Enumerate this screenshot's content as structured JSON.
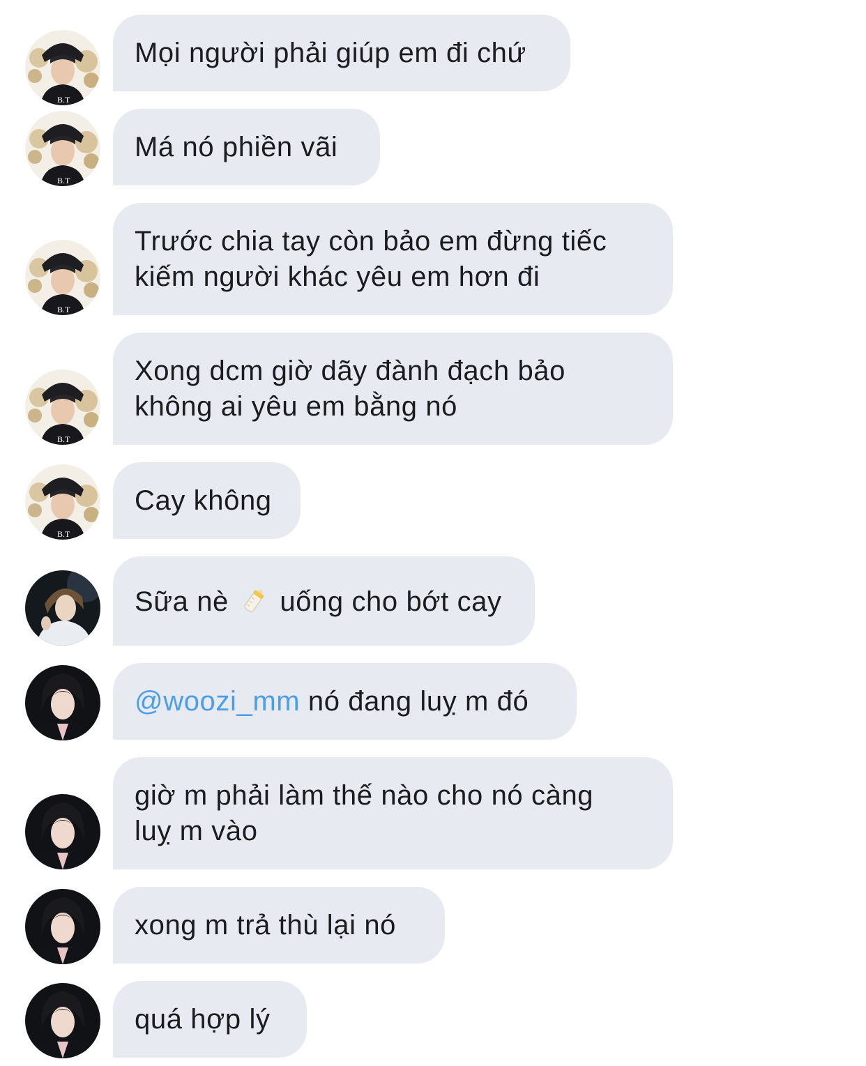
{
  "conversation": {
    "messages": [
      {
        "sender": "user-a",
        "text": "Mọi người phải giúp em đi chứ"
      },
      {
        "sender": "user-a",
        "text": "Má nó phiền vãi"
      },
      {
        "sender": "user-a",
        "line1": "Trước chia tay còn bảo em đừng tiếc",
        "line2": "kiếm người khác yêu em hơn đi"
      },
      {
        "sender": "user-a",
        "line1": "Xong dcm giờ dãy đành đạch bảo",
        "line2": "không ai yêu em bằng nó"
      },
      {
        "sender": "user-a",
        "text": "Cay không"
      },
      {
        "sender": "user-b",
        "before": "Sữa nè",
        "emoji": "baby-bottle-icon",
        "after": "uống cho bớt cay"
      },
      {
        "sender": "user-c",
        "mention": "@woozi_mm",
        "after": "nó đang luỵ m đó"
      },
      {
        "sender": "user-c",
        "line1": "giờ m phải làm thế nào cho nó càng",
        "line2": "luỵ m vào"
      },
      {
        "sender": "user-c",
        "text": "xong m trả thù lại nó"
      },
      {
        "sender": "user-c",
        "text": "quá hợp lý"
      }
    ]
  },
  "colors": {
    "bubble_background": "#e7eaf0",
    "text": "#1c1c1e",
    "mention": "#4a9fe8",
    "page_background": "#ffffff"
  }
}
